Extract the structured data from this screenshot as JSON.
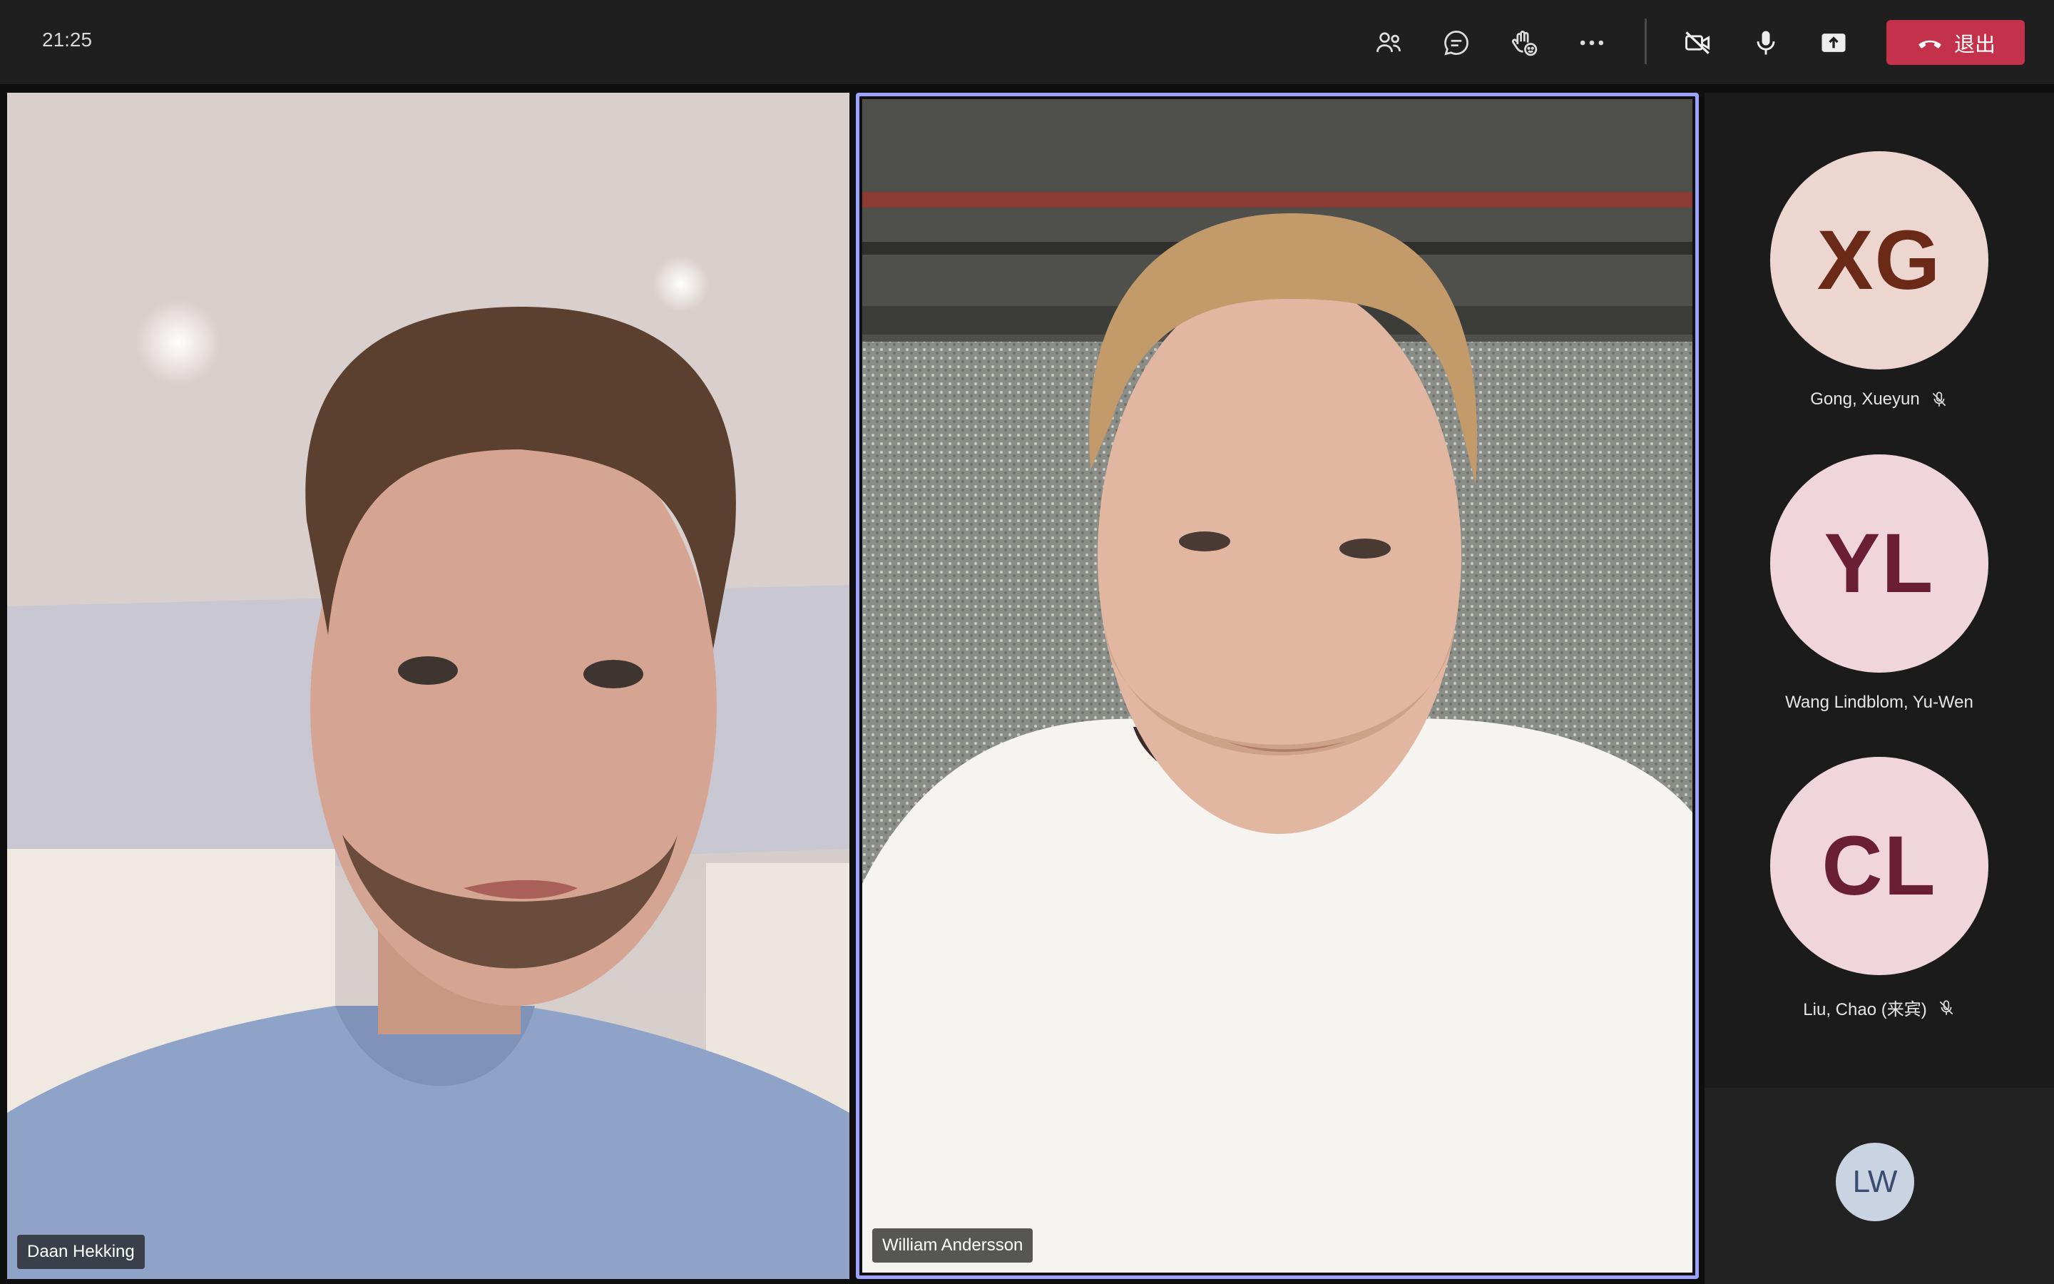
{
  "topbar": {
    "clock": "21:25",
    "buttons": [
      {
        "name": "people-icon"
      },
      {
        "name": "chat-icon"
      },
      {
        "name": "reactions-icon"
      },
      {
        "name": "more-options-icon"
      },
      {
        "name": "camera-off-icon"
      },
      {
        "name": "microphone-icon"
      },
      {
        "name": "share-screen-icon"
      }
    ],
    "leave_label": "退出",
    "leave_color": "#c4314b"
  },
  "videos": [
    {
      "name": "Daan Hekking"
    },
    {
      "name": "William Andersson",
      "highlight_color": "#9ea2ff"
    }
  ],
  "participants": [
    {
      "initials": "XG",
      "name": "Gong, Xueyun",
      "muted": true,
      "bg": "#ecd6cf",
      "fg": "#6b2a17"
    },
    {
      "initials": "YL",
      "name": "Wang Lindblom, Yu-Wen",
      "muted": false,
      "bg": "#f1d5dd",
      "fg": "#6a1f36"
    },
    {
      "initials": "CL",
      "name": "Liu, Chao (来宾)",
      "muted": true,
      "bg": "#f1d5dd",
      "fg": "#6a1f36"
    }
  ],
  "overflow_participant": {
    "initials": "LW",
    "bg": "#c9d3e2",
    "fg": "#3a4d70"
  }
}
